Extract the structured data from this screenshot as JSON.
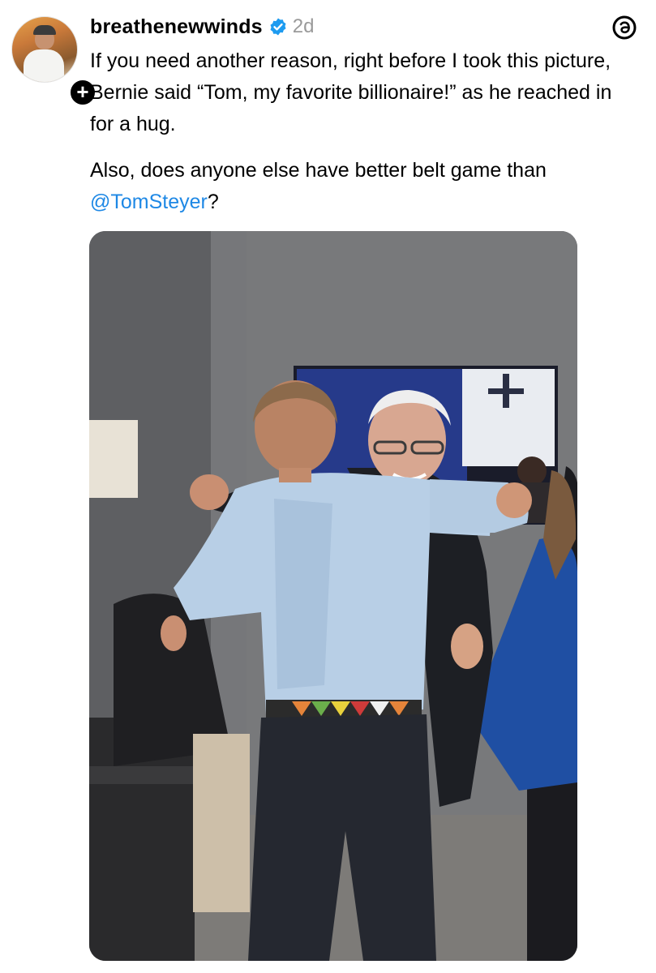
{
  "post": {
    "username": "breathenewwinds",
    "timestamp": "2d",
    "follow_symbol": "+",
    "text_line_1": "If you need another reason, right before I took this picture, Bernie said “Tom, my favorite billionaire!” as he reached in for a hug.",
    "text_line_2_prefix": "Also, does anyone else have better belt game than ",
    "mention": "@TomSteyer",
    "text_line_2_suffix": "?",
    "icons": {
      "avatar": "profile-avatar",
      "follow": "plus-icon",
      "verified": "verified-badge-icon",
      "app": "threads-logo-icon"
    },
    "colors": {
      "mention": "#1e88e5",
      "verified": "#1d9bf0",
      "timestamp": "#9a9a9a"
    }
  }
}
